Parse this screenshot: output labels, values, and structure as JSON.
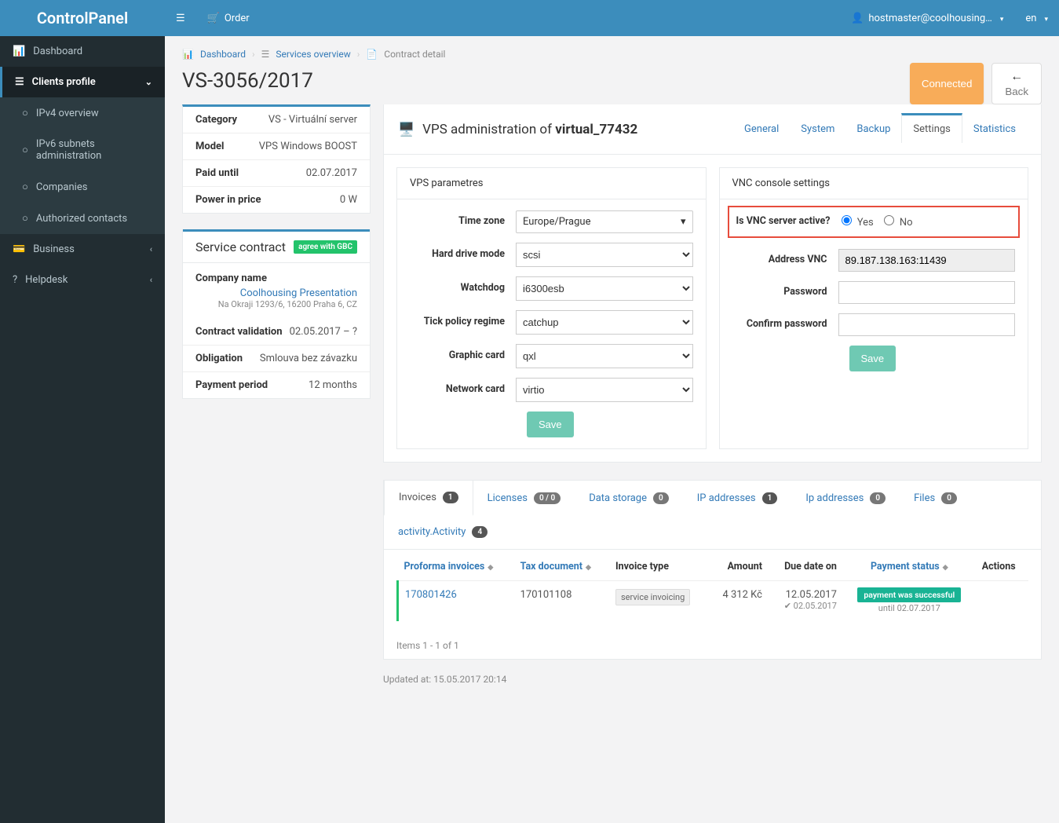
{
  "brand": "ControlPanel",
  "top": {
    "order": "Order",
    "user": "hostmaster@coolhousing…",
    "lang": "en"
  },
  "sidebar": {
    "dashboard": "Dashboard",
    "clients": "Clients profile",
    "ipv4": "IPv4 overview",
    "ipv6": "IPv6 subnets administration",
    "companies": "Companies",
    "contacts": "Authorized contacts",
    "business": "Business",
    "helpdesk": "Helpdesk"
  },
  "breadcrumb": {
    "dashboard": "Dashboard",
    "services": "Services overview",
    "contract": "Contract detail"
  },
  "page": {
    "title": "VS-3056/2017",
    "connected": "Connected",
    "back": "Back"
  },
  "info": {
    "category_l": "Category",
    "category_v": "VS - Virtuální server",
    "model_l": "Model",
    "model_v": "VPS Windows BOOST",
    "paid_l": "Paid until",
    "paid_v": "02.07.2017",
    "power_l": "Power in price",
    "power_v": "0 W"
  },
  "contract": {
    "title": "Service contract",
    "badge": "agree with GBC",
    "company_l": "Company name",
    "company_v": "Coolhousing Presentation",
    "address": "Na Okraji 1293/6, 16200 Praha 6, CZ",
    "valid_l": "Contract validation",
    "valid_v": "02.05.2017 – ?",
    "oblig_l": "Obligation",
    "oblig_v": "Smlouva bez závazku",
    "period_l": "Payment period",
    "period_v": "12 months"
  },
  "vps": {
    "title_pre": "VPS administration of ",
    "title_strong": "virtual_77432",
    "tabs": {
      "general": "General",
      "system": "System",
      "backup": "Backup",
      "settings": "Settings",
      "statistics": "Statistics"
    }
  },
  "params": {
    "title": "VPS parametres",
    "labels": {
      "tz": "Time zone",
      "hdd": "Hard drive mode",
      "watchdog": "Watchdog",
      "tick": "Tick policy regime",
      "gfx": "Graphic card",
      "net": "Network card"
    },
    "values": {
      "tz": "Europe/Prague",
      "hdd": "scsi",
      "watchdog": "i6300esb",
      "tick": "catchup",
      "gfx": "qxl",
      "net": "virtio"
    },
    "save": "Save"
  },
  "vnc": {
    "title": "VNC console settings",
    "active_l": "Is VNC server active?",
    "yes": "Yes",
    "no": "No",
    "addr_l": "Address VNC",
    "addr_v": "89.187.138.163:11439",
    "pass_l": "Password",
    "cpass_l": "Confirm password",
    "save": "Save"
  },
  "btabs": {
    "invoices": "Invoices",
    "invoices_b": "1",
    "licenses": "Licenses",
    "licenses_b": "0 / 0",
    "storage": "Data storage",
    "storage_b": "0",
    "ip_upper": "IP addresses",
    "ip_upper_b": "1",
    "ip_lower": "Ip addresses",
    "ip_lower_b": "0",
    "files": "Files",
    "files_b": "0",
    "activity": "activity.Activity",
    "activity_b": "4"
  },
  "table": {
    "h_proforma": "Proforma invoices",
    "h_tax": "Tax document",
    "h_type": "Invoice type",
    "h_amount": "Amount",
    "h_due": "Due date on",
    "h_status": "Payment status",
    "h_actions": "Actions",
    "row": {
      "proforma": "170801426",
      "tax": "170101108",
      "type": "service invoicing",
      "amount": "4 312 Kč",
      "due": "12.05.2017",
      "due2": "02.05.2017",
      "status": "payment was successful",
      "status_sub": "until 02.07.2017"
    },
    "footer": "Items 1 - 1 of 1"
  },
  "updated": "Updated at: 15.05.2017 20:14"
}
